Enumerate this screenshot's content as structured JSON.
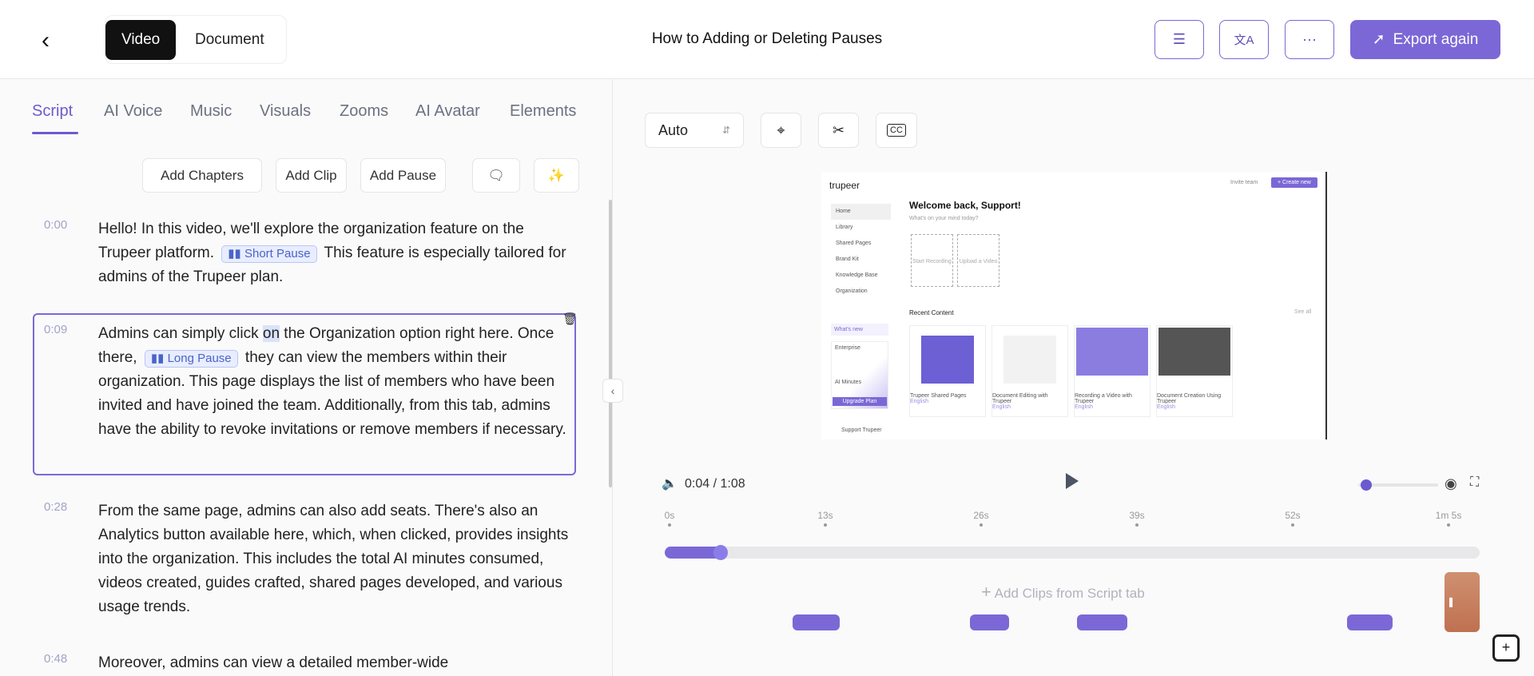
{
  "header": {
    "back_icon": "chevron-left",
    "toggle": [
      "Video",
      "Document"
    ],
    "title": "How to Adding or Deleting Pauses",
    "export_label": "Export again",
    "accent": "#7b68d6"
  },
  "tabs": [
    "Script",
    "AI Voice",
    "Music",
    "Visuals",
    "Zooms",
    "AI Avatar",
    "Elements"
  ],
  "actions": {
    "add_chapters": "Add Chapters",
    "add_clip": "Add Clip",
    "add_pause": "Add Pause"
  },
  "script": [
    {
      "time": "0:00",
      "a": "Hello! In this video, we'll explore the organization feature on the Trupeer platform.",
      "pause": "Short Pause",
      "b": "This feature is especially tailored for admins of the Trupeer plan."
    },
    {
      "time": "0:09",
      "a1": "Admins can simply click ",
      "hl": "on",
      "a2": " the Organization option right here. Once there,",
      "pause": "Long Pause",
      "b": "they can view the members within their organization. This page displays the list of members who have been invited and have joined the team. Additionally, from this tab, admins have the ability to revoke invitations or remove members if necessary."
    },
    {
      "time": "0:28",
      "a": "From the same page, admins can also add seats. There's also an Analytics button available here, which, when clicked, provides insights into the organization. This includes the total AI minutes consumed, videos created, guides crafted, shared pages developed, and various usage trends."
    },
    {
      "time": "0:48",
      "a": "Moreover, admins can view a detailed member-wide"
    }
  ],
  "player": {
    "aspect": "Auto",
    "time": "0:04 / 1:08",
    "progress": 0.06,
    "volume": 0.05,
    "ticks": [
      "0s",
      "13s",
      "26s",
      "39s",
      "52s",
      "1m 5s"
    ],
    "add_clips": "Add Clips from Script tab"
  },
  "preview": {
    "logo": "trupeer",
    "invite": "Invite team",
    "create": "+ Create new",
    "nav": [
      "Home",
      "Library",
      "Shared Pages",
      "Brand Kit",
      "Knowledge Base",
      "Organization"
    ],
    "welcome": "Welcome back, Support!",
    "sub": "What's on your mind today?",
    "start": "Start Recording",
    "upload": "Upload a Video",
    "recent": "Recent Content",
    "see_all": "See all",
    "whats_new": "What's new",
    "plan": "Enterprise",
    "ai_minutes": "AI Minutes",
    "upgrade": "Upgrade Plan",
    "user": "Support Trupeer",
    "cards": [
      "Trupeer Shared Pages",
      "Document Editing with Trupeer",
      "Recording a Video with Trupeer",
      "Document Creation Using Trupeer"
    ],
    "lang": "English"
  }
}
